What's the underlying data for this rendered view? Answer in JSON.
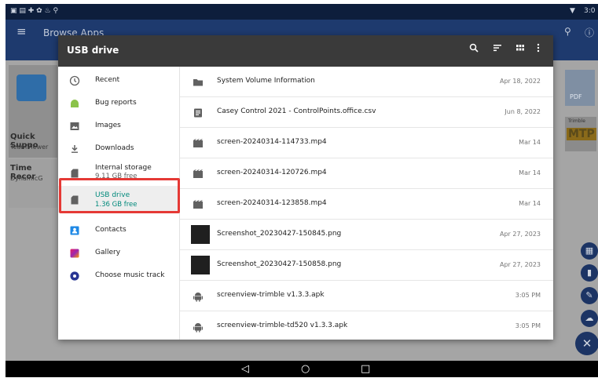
{
  "status_bar": {
    "time": "3:0"
  },
  "background_app": {
    "title": "Browse Apps",
    "cards": [
      {
        "name": "Quick Suppo",
        "sub": "TeamViewer"
      },
      {
        "name": "Time Recor",
        "sub": "DynamicG"
      }
    ],
    "right_badges": [
      "PDF",
      "Trimble",
      "MTP"
    ]
  },
  "dialog": {
    "title": "USB drive",
    "sidebar": [
      {
        "label": "Recent",
        "sub": ""
      },
      {
        "label": "Bug reports",
        "sub": ""
      },
      {
        "label": "Images",
        "sub": ""
      },
      {
        "label": "Downloads",
        "sub": ""
      },
      {
        "label": "Internal storage",
        "sub": "9.11 GB free"
      },
      {
        "label": "USB drive",
        "sub": "1.36 GB free"
      },
      {
        "label": "Contacts",
        "sub": ""
      },
      {
        "label": "Gallery",
        "sub": ""
      },
      {
        "label": "Choose music track",
        "sub": ""
      }
    ],
    "files": [
      {
        "name": "System Volume Information",
        "date": "Apr 18, 2022"
      },
      {
        "name": "Casey Control 2021 - ControlPoints.office.csv",
        "date": "Jun 8, 2022"
      },
      {
        "name": "screen-20240314-114733.mp4",
        "date": "Mar 14"
      },
      {
        "name": "screen-20240314-120726.mp4",
        "date": "Mar 14"
      },
      {
        "name": "screen-20240314-123858.mp4",
        "date": "Mar 14"
      },
      {
        "name": "Screenshot_20230427-150845.png",
        "date": "Apr 27, 2023"
      },
      {
        "name": "Screenshot_20230427-150858.png",
        "date": "Apr 27, 2023"
      },
      {
        "name": "screenview-trimble v1.3.3.apk",
        "date": "3:05 PM"
      },
      {
        "name": "screenview-trimble-td520 v1.3.3.apk",
        "date": "3:05 PM"
      }
    ]
  },
  "colors": {
    "accent": "#00897b",
    "highlight": "#e53935",
    "titlebar": "#3a3a3a"
  }
}
